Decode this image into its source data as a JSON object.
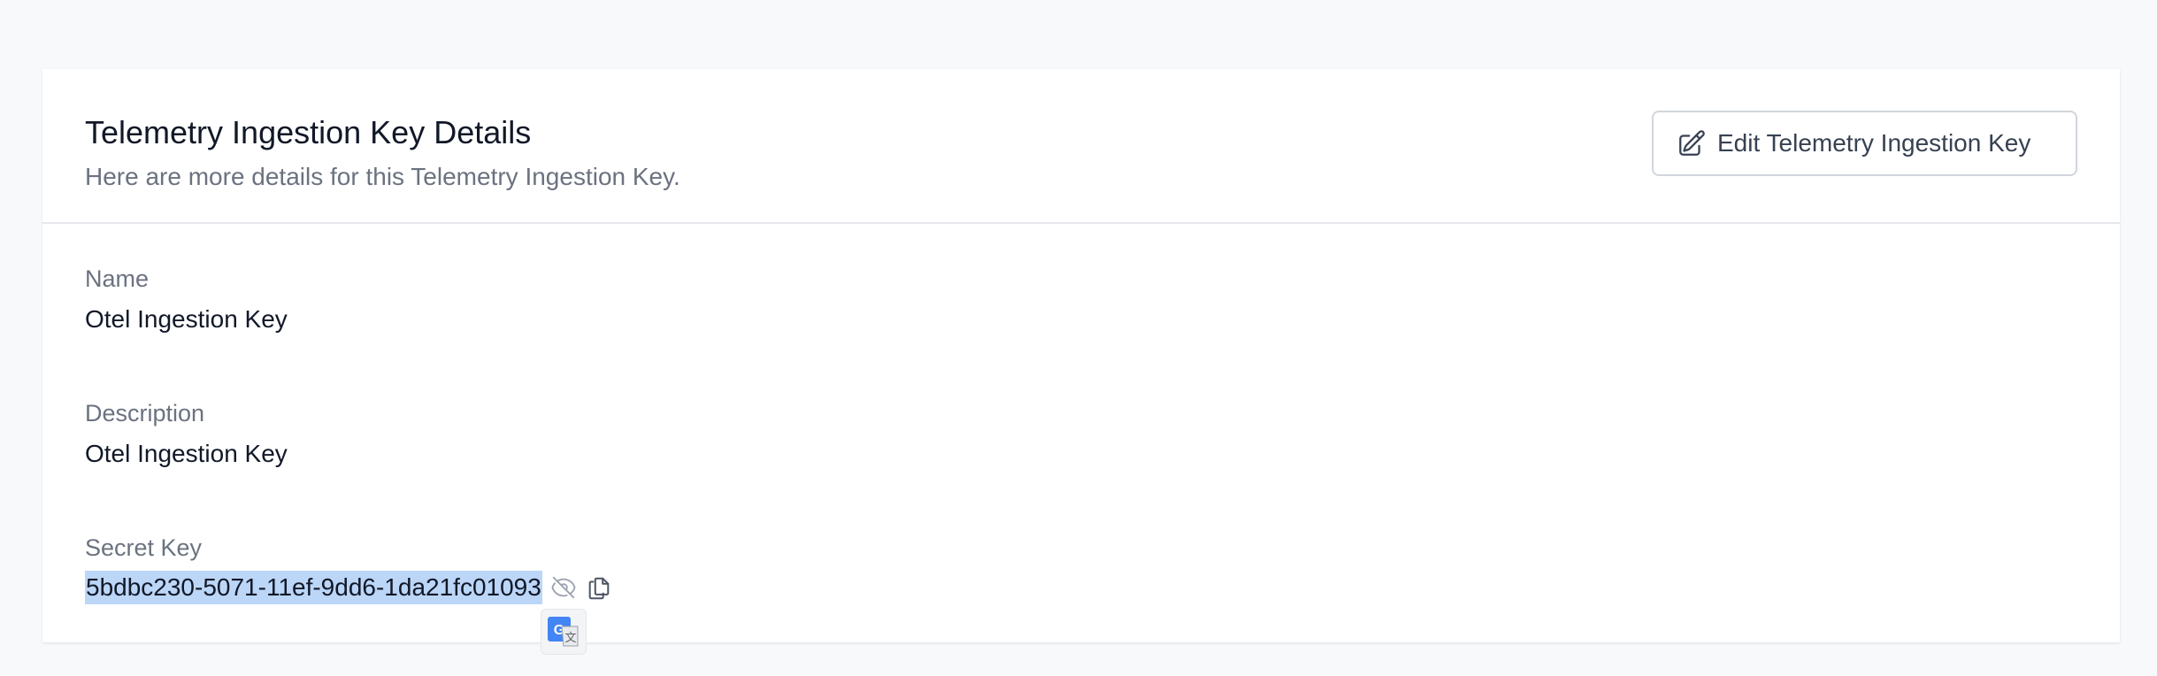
{
  "header": {
    "title": "Telemetry Ingestion Key Details",
    "subtitle": "Here are more details for this Telemetry Ingestion Key.",
    "edit_button_label": "Edit Telemetry Ingestion Key",
    "edit_button_icon": "pencil-square-icon"
  },
  "fields": {
    "name": {
      "label": "Name",
      "value": "Otel Ingestion Key"
    },
    "description": {
      "label": "Description",
      "value": "Otel Ingestion Key"
    },
    "secret_key": {
      "label": "Secret Key",
      "value": "5bdbc230-5071-11ef-9dd6-1da21fc01093",
      "hide_icon": "eye-slash-icon",
      "copy_icon": "copy-icon",
      "selected": true
    }
  },
  "overlay": {
    "translate_icon": "google-translate-icon"
  },
  "colors": {
    "page_bg": "#f8f9fb",
    "card_bg": "#ffffff",
    "selection": "#bcd6f8",
    "label": "#6b7280",
    "text": "#111827",
    "translate_blue": "#4285f4"
  }
}
